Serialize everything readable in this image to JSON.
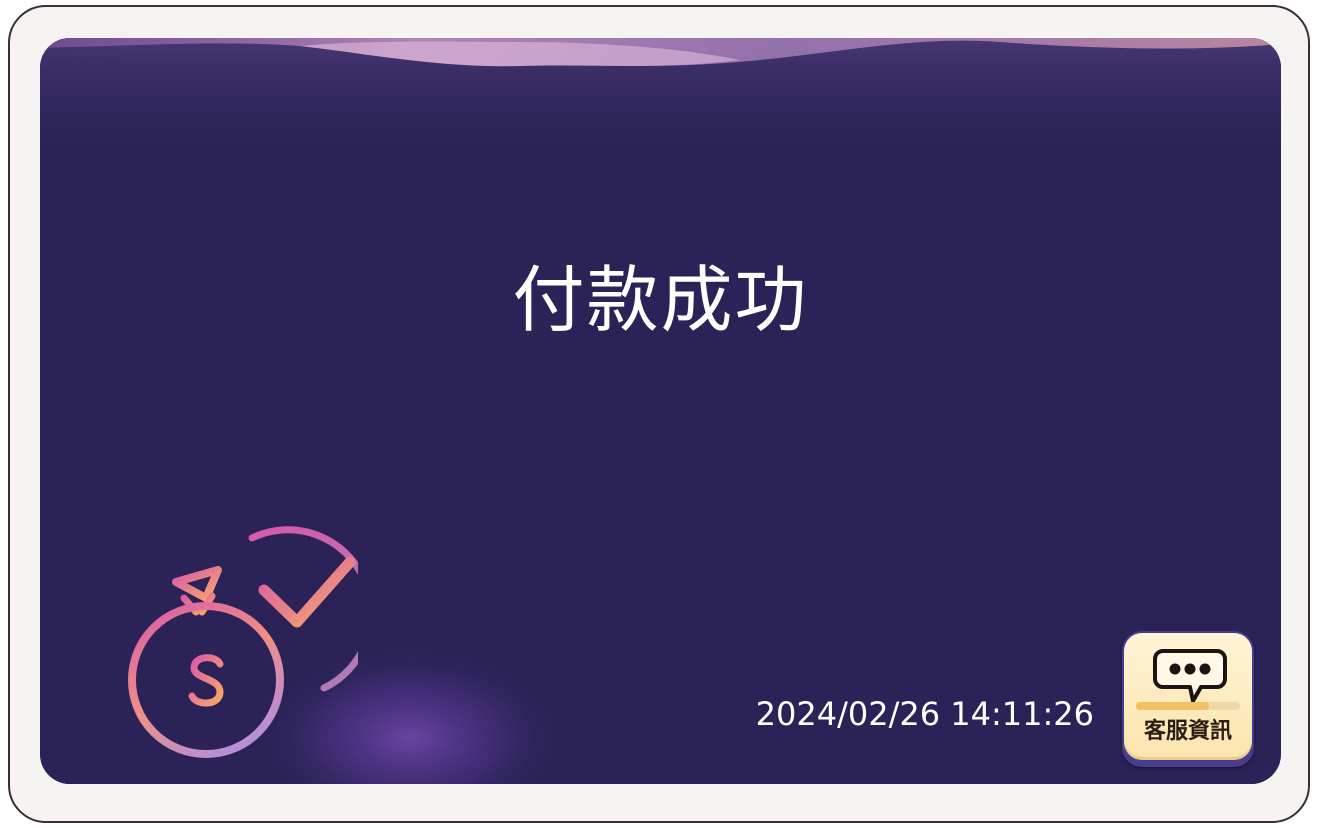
{
  "screen": {
    "title": "付款成功",
    "timestamp": "2024/02/26 14:11:26"
  },
  "illustration": {
    "icons": [
      "money-bag-icon",
      "dollar-sign-icon",
      "check-circle-icon"
    ]
  },
  "support_button": {
    "label": "客服資訊",
    "icon": "chat-bubble-icon",
    "progress_fraction": 0.7
  },
  "colors": {
    "frame_background": "#f6f4f2",
    "frame_border": "#3a302e",
    "screen_background": "#2b2358",
    "accent_gradient_start": "#d85aa8",
    "accent_gradient_end": "#f7a86a",
    "support_button_background": "#fbe4ad",
    "text_primary": "#ffffff"
  }
}
